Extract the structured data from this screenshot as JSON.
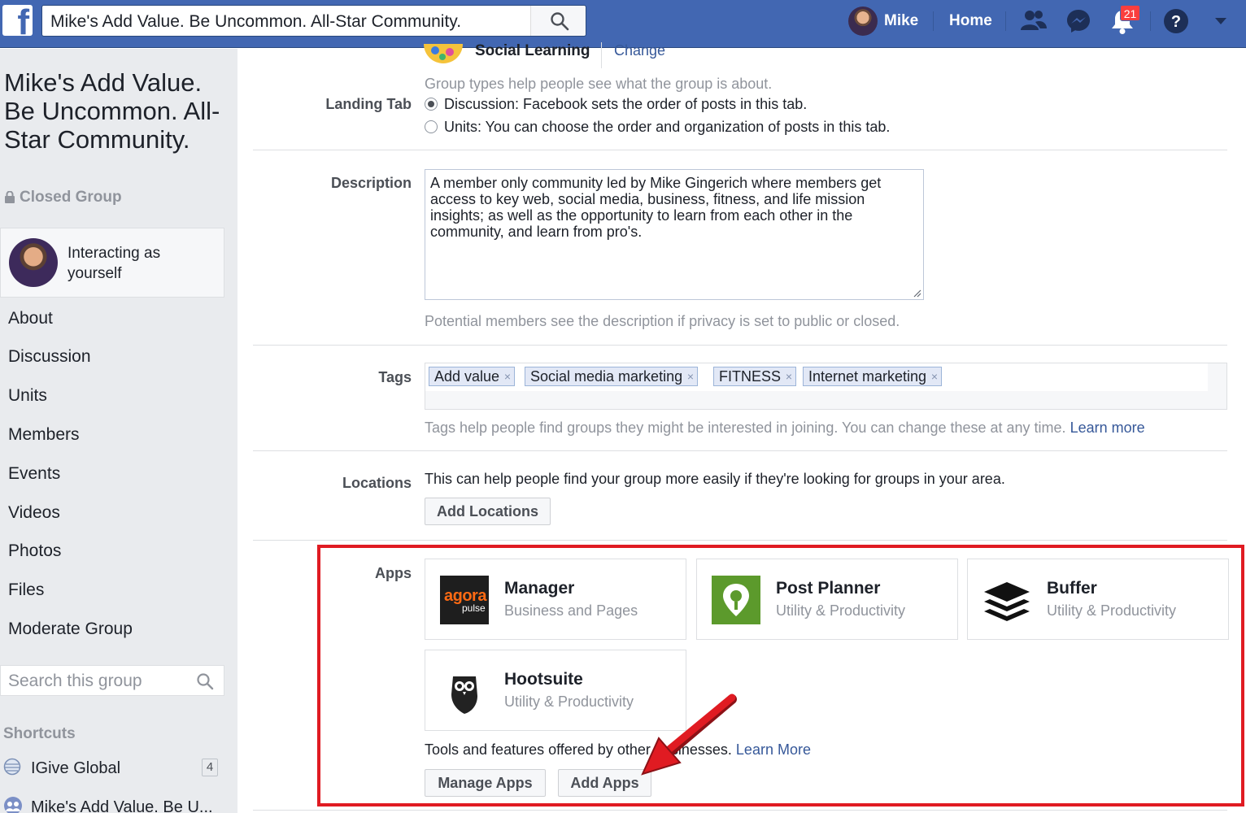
{
  "colors": {
    "fb_blue": "#4267b2",
    "link": "#365899",
    "highlight_red": "#e01b22",
    "notif_red": "#fa3e3e"
  },
  "topbar": {
    "logo_glyph": "f",
    "search_value": "Mike's Add Value. Be Uncommon. All-Star Community.",
    "user_name": "Mike",
    "home_label": "Home",
    "notification_count": "21",
    "icons": [
      "search-icon",
      "friends-icon",
      "messenger-icon",
      "notifications-icon",
      "help-icon",
      "dropdown-icon"
    ]
  },
  "sidebar": {
    "group_title": "Mike's Add Value. Be Uncommon. All-Star Community.",
    "privacy": "Closed Group",
    "interacting_as": "Interacting as yourself",
    "nav": [
      "About",
      "Discussion",
      "Units",
      "Members",
      "Events",
      "Videos",
      "Photos",
      "Files",
      "Moderate Group"
    ],
    "search_placeholder": "Search this group",
    "shortcuts_title": "Shortcuts",
    "shortcuts": [
      {
        "label": "IGive Global",
        "count": "4"
      },
      {
        "label": "Mike's Add Value. Be U..."
      }
    ]
  },
  "settings": {
    "group_type": {
      "value": "Social Learning",
      "change_link": "Change",
      "hint": "Group types help people see what the group is about."
    },
    "landing_tab": {
      "label": "Landing Tab",
      "options": [
        {
          "text": "Discussion: Facebook sets the order of posts in this tab.",
          "checked": true
        },
        {
          "text": "Units: You can choose the order and organization of posts in this tab.",
          "checked": false
        }
      ]
    },
    "description": {
      "label": "Description",
      "value": "A member only community led by Mike Gingerich where members get access to key web, social media, business, fitness, and life mission insights; as well as the opportunity to learn from each other in the community, and  learn from pro's.",
      "hint": "Potential members see the description if privacy is set to public or closed."
    },
    "tags": {
      "label": "Tags",
      "items": [
        "Add value",
        "Social media marketing",
        "FITNESS",
        "Internet marketing"
      ],
      "remove_glyph": "×",
      "hint": "Tags help people find groups they might be interested in joining. You can change these at any time.",
      "learn_more": "Learn more"
    },
    "locations": {
      "label": "Locations",
      "hint": "This can help people find your group more easily if they're looking for groups in your area.",
      "button": "Add Locations"
    },
    "apps": {
      "label": "Apps",
      "items": [
        {
          "name": "Manager",
          "category": "Business and Pages",
          "logo_text": "agora",
          "logo_sub": "pulse"
        },
        {
          "name": "Post Planner",
          "category": "Utility & Productivity"
        },
        {
          "name": "Buffer",
          "category": "Utility & Productivity"
        },
        {
          "name": "Hootsuite",
          "category": "Utility & Productivity"
        }
      ],
      "footer": "Tools and features offered by other businesses.",
      "learn_more": "Learn More",
      "manage_button": "Manage Apps",
      "add_button": "Add Apps"
    }
  }
}
